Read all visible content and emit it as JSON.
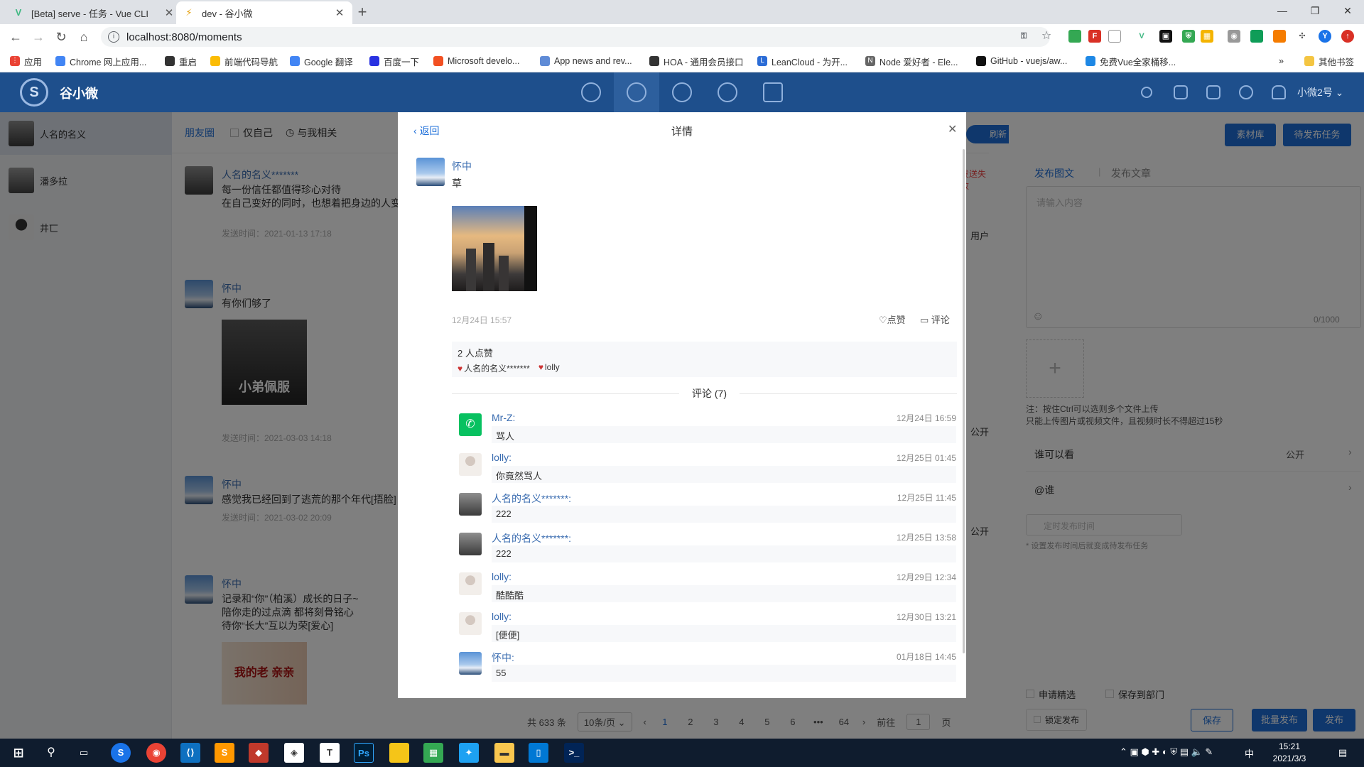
{
  "browser": {
    "tabs": [
      {
        "title": "[Beta] serve - 任务 - Vue CLI",
        "active": false
      },
      {
        "title": "dev - 谷小微",
        "active": true
      }
    ],
    "url": "localhost:8080/moments",
    "bookmarks": [
      "应用",
      "Chrome 网上应用...",
      "重启",
      "前端代码导航",
      "Google 翻译",
      "百度一下",
      "Microsoft develo...",
      "App news and rev...",
      "HOA - 通用会员接口",
      "LeanCloud - 为开...",
      "Node 爱好者 - Ele...",
      "GitHub - vuejs/aw...",
      "免费Vue全家桶移..."
    ],
    "other_bookmarks": "其他书签"
  },
  "app": {
    "name": "谷小微",
    "user": "小微2号 ⌄",
    "colors": {
      "header": "#1e4f8c",
      "accent": "#1e6fd9"
    }
  },
  "sidebar": {
    "accounts": [
      "人名的名义",
      "潘多拉",
      "井匸"
    ]
  },
  "feed": {
    "tabs": [
      "朋友圈",
      "仅自己",
      "与我相关"
    ],
    "refresh": "刷新",
    "send_fail": "发送失败",
    "posts": [
      {
        "name": "人名的名义*******",
        "lines": [
          "每一份信任都值得珍心对待",
          "在自己变好的同时，也想着把身边的人变"
        ],
        "time": "发送时间：2021-01-13 17:18",
        "extra": "用户"
      },
      {
        "name": "怀中",
        "lines": [
          "有你们够了"
        ],
        "image_caption": "小弟佩服",
        "time": "发送时间：2021-03-03 14:18",
        "extra": "公开"
      },
      {
        "name": "怀中",
        "lines": [
          "感觉我已经回到了逃荒的那个年代[捂脸]"
        ],
        "time": "发送时间：2021-03-02 20:09",
        "extra": "公开"
      },
      {
        "name": "怀中",
        "lines": [
          "记录和“你”（柏溪）成长的日子~",
          "陪你走的过点滴 都将刻骨铭心",
          "待你“长大”互以为荣[爱心]"
        ],
        "image_caption": "我的老 亲亲"
      }
    ],
    "pagination": {
      "total": "共 633 条",
      "size": "10条/页",
      "pages": [
        "1",
        "2",
        "3",
        "4",
        "5",
        "6",
        "•••",
        "64"
      ],
      "current": "1",
      "goto_label": "前往",
      "goto_value": "1",
      "goto_suffix": "页"
    }
  },
  "right_panel": {
    "buttons": [
      "素材库",
      "待发布任务"
    ],
    "tabs": [
      "发布图文",
      "发布文章"
    ],
    "placeholder": "请输入内容",
    "counter": "0/1000",
    "upload_note_1": "注：按住Ctrl可以选则多个文件上传",
    "upload_note_2": "只能上传图片或视频文件，且视频时长不得超过15秒",
    "who_can_see": "谁可以看",
    "who_value": "公开",
    "mention": "@谁",
    "schedule_placeholder": "定时发布时间",
    "schedule_note": "* 设置发布时间后就变成待发布任务",
    "checks": [
      "申请精选",
      "保存到部门",
      "锁定发布"
    ],
    "actions": [
      "保存",
      "批量发布",
      "发布"
    ]
  },
  "modal": {
    "back": "返回",
    "title": "详情",
    "author": "怀中",
    "text": "草",
    "time": "12月24日 15:57",
    "like_label": "点赞",
    "comment_label": "评论",
    "like_count": "2 人点赞",
    "likers": [
      "人名的名义*******",
      "lolly"
    ],
    "comments_header": "评论 (7)",
    "comments": [
      {
        "name": "Mr-Z:",
        "time": "12月24日 16:59",
        "text": "骂人",
        "avatar": "wechat"
      },
      {
        "name": "lolly:",
        "time": "12月25日 01:45",
        "text": "你竟然骂人",
        "avatar": "lolly"
      },
      {
        "name": "人名的名义*******:",
        "time": "12月25日 11:45",
        "text": "222",
        "avatar": "renming"
      },
      {
        "name": "人名的名义*******:",
        "time": "12月25日 13:58",
        "text": "222",
        "avatar": "renming"
      },
      {
        "name": "lolly:",
        "time": "12月29日 12:34",
        "text": "酷酷酷",
        "avatar": "lolly"
      },
      {
        "name": "lolly:",
        "time": "12月30日 13:21",
        "text": "[便便]",
        "avatar": "lolly"
      },
      {
        "name": "怀中:",
        "time": "01月18日 14:45",
        "text": "55",
        "avatar": "huaizhong"
      }
    ]
  },
  "taskbar": {
    "time": "15:21",
    "date": "2021/3/3",
    "ime": "中"
  }
}
